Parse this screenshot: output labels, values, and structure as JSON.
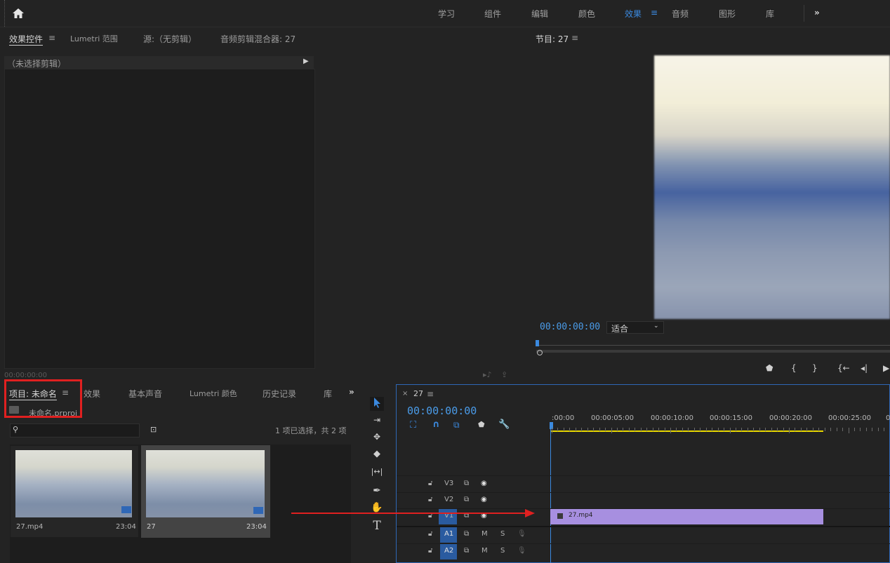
{
  "topbar": {
    "home_icon": "home-icon",
    "workspaces": [
      "学习",
      "组件",
      "编辑",
      "颜色",
      "效果",
      "音频",
      "图形",
      "库"
    ],
    "active_workspace": "效果",
    "more_icon": "»"
  },
  "source_panel": {
    "tabs": [
      "效果控件",
      "Lumetri 范围",
      "源:（无剪辑）",
      "音频剪辑混合器: 27"
    ],
    "header": "（未选择剪辑）",
    "timecode": "00:00:00:00"
  },
  "program_monitor": {
    "title": "节目: 27",
    "timecode": "00:00:00:00",
    "fit": "适合"
  },
  "project_panel": {
    "tabs": [
      "项目: 未命名",
      "效果",
      "基本声音",
      "Lumetri 颜色",
      "历史记录",
      "库"
    ],
    "project_file": "未命名.prproj",
    "selection_info": "1 项已选择，共 2 项",
    "items": [
      {
        "name": "27.mp4",
        "duration": "23:04"
      },
      {
        "name": "27",
        "duration": "23:04"
      }
    ]
  },
  "timeline": {
    "sequence": "27",
    "timecode": "00:00:00:00",
    "ruler_labels": [
      ":00:00",
      "00:00:05:00",
      "00:00:10:00",
      "00:00:15:00",
      "00:00:20:00",
      "00:00:25:00",
      "0"
    ],
    "video_tracks": [
      "V3",
      "V2",
      "V1"
    ],
    "audio_tracks": [
      "A1",
      "A2"
    ],
    "track_m": "M",
    "track_s": "S",
    "clip_name": "27.mp4"
  },
  "colors": {
    "accent_blue": "#3b8ae0",
    "clip_purple": "#a78fe0",
    "highlight_red": "#e02020",
    "work_area_yellow": "#e8d800"
  }
}
